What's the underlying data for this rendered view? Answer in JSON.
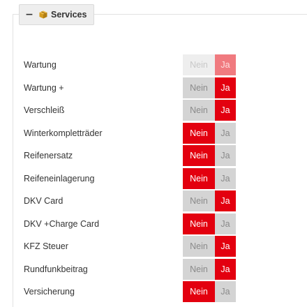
{
  "section": {
    "title": "Services",
    "collapse_symbol": "−",
    "icon": "package-icon"
  },
  "colors": {
    "active": "#e3000f",
    "inactive": "#d4d4d4",
    "disabled_active": "#f07a7f",
    "disabled_inactive": "#eeeeee"
  },
  "toggle_labels": {
    "no": "Nein",
    "yes": "Ja"
  },
  "services": [
    {
      "key": "wartung",
      "label": "Wartung",
      "value": "Ja",
      "disabled": true
    },
    {
      "key": "wartung-plus",
      "label": "Wartung +",
      "value": "Ja",
      "disabled": false
    },
    {
      "key": "verschleiss",
      "label": "Verschleiß",
      "value": "Ja",
      "disabled": false
    },
    {
      "key": "winterkompletraeder",
      "label": "Winterkompletträder",
      "value": "Nein",
      "disabled": false
    },
    {
      "key": "reifenersatz",
      "label": "Reifenersatz",
      "value": "Nein",
      "disabled": false
    },
    {
      "key": "reifeneinlagerung",
      "label": "Reifeneinlagerung",
      "value": "Nein",
      "disabled": false
    },
    {
      "key": "dkv-card",
      "label": "DKV Card",
      "value": "Ja",
      "disabled": false
    },
    {
      "key": "dkv-charge-card",
      "label": "DKV +Charge Card",
      "value": "Nein",
      "disabled": false
    },
    {
      "key": "kfz-steuer",
      "label": "KFZ Steuer",
      "value": "Ja",
      "disabled": false
    },
    {
      "key": "rundfunkbeitrag",
      "label": "Rundfunkbeitrag",
      "value": "Ja",
      "disabled": false
    },
    {
      "key": "versicherung",
      "label": "Versicherung",
      "value": "Nein",
      "disabled": false
    }
  ]
}
